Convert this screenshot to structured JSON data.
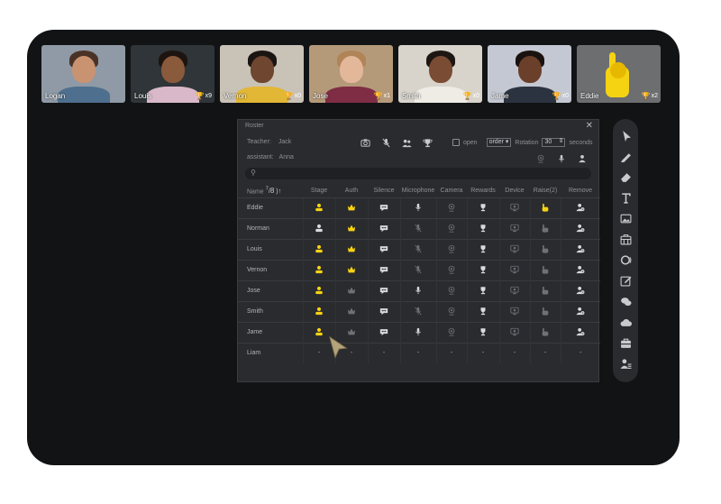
{
  "videos": [
    {
      "name": "Logan",
      "reward": "",
      "bg": "#8f9aa6",
      "skin": "#c99372",
      "hair": "#4a3326",
      "shirt": "#4f6f8e"
    },
    {
      "name": "Louis",
      "reward": "x9",
      "bg": "#2f3538",
      "skin": "#8a5a3c",
      "hair": "#1d1410",
      "shirt": "#d9b8c9"
    },
    {
      "name": "Vernon",
      "reward": "x0",
      "bg": "#c9c2b6",
      "skin": "#6f4630",
      "hair": "#1b1512",
      "shirt": "#e2b735"
    },
    {
      "name": "Jose",
      "reward": "x1",
      "bg": "#b59a7a",
      "skin": "#e3b79a",
      "hair": "#b08456",
      "shirt": "#7e2d45"
    },
    {
      "name": "Smith",
      "reward": "x0",
      "bg": "#d8d4cc",
      "skin": "#7a4c33",
      "hair": "#1e1612",
      "shirt": "#efece6"
    },
    {
      "name": "Jame",
      "reward": "x0",
      "bg": "#c4c8d2",
      "skin": "#6a402b",
      "hair": "#1a120e",
      "shirt": "#2c3340"
    },
    {
      "name": "Eddie",
      "reward": "x2",
      "bg": "#6c6e70",
      "skin": "#f5d312",
      "hair": "#f5d312",
      "shirt": "#f5d312"
    }
  ],
  "roster": {
    "title": "Roster",
    "close": "✕",
    "teacher_label": "Teacher:",
    "teacher_name": "Jack",
    "assistant_label": "assistant:",
    "assistant_name": "Anna",
    "open_label": "open",
    "order_value": "order ▾",
    "rotation_label": "Rotation",
    "rotation_value": "30",
    "seconds_label": "seconds",
    "search_placeholder": "",
    "sort_count": "7",
    "sort_total": "8",
    "columns": [
      "Name",
      "Stage",
      "Auth",
      "Silence",
      "Microphone",
      "Camera",
      "Rewards",
      "Device",
      "Raise(2)",
      "Remove"
    ],
    "rows": [
      {
        "name": "Eddie",
        "stage": "y",
        "auth": "y",
        "silence": "w",
        "mic": "w",
        "camera": "d",
        "rewards": "w",
        "device": "d",
        "raise": "y",
        "remove": "w"
      },
      {
        "name": "Norman",
        "stage": "w",
        "auth": "y",
        "silence": "w",
        "mic": "d",
        "camera": "d",
        "rewards": "w",
        "device": "d",
        "raise": "d",
        "remove": "w"
      },
      {
        "name": "Louis",
        "stage": "y",
        "auth": "y",
        "silence": "w",
        "mic": "d",
        "camera": "d",
        "rewards": "w",
        "device": "d",
        "raise": "d",
        "remove": "w"
      },
      {
        "name": "Vernon",
        "stage": "y",
        "auth": "y",
        "silence": "w",
        "mic": "d",
        "camera": "d",
        "rewards": "w",
        "device": "d",
        "raise": "d",
        "remove": "w"
      },
      {
        "name": "Jose",
        "stage": "y",
        "auth": "d",
        "silence": "w",
        "mic": "w",
        "camera": "d",
        "rewards": "w",
        "device": "d",
        "raise": "d",
        "remove": "w"
      },
      {
        "name": "Smith",
        "stage": "y",
        "auth": "d",
        "silence": "w",
        "mic": "d",
        "camera": "d",
        "rewards": "w",
        "device": "d",
        "raise": "d",
        "remove": "w"
      },
      {
        "name": "Jame",
        "stage": "y",
        "auth": "d",
        "silence": "w",
        "mic": "w",
        "camera": "d",
        "rewards": "w",
        "device": "d",
        "raise": "d",
        "remove": "w"
      },
      {
        "name": "Liam",
        "stage": "-",
        "auth": "-",
        "silence": "-",
        "mic": "-",
        "camera": "-",
        "rewards": "-",
        "device": "-",
        "raise": "-",
        "remove": "-"
      }
    ]
  },
  "toolbar": [
    "select-tool",
    "pen-tool",
    "eraser-tool",
    "text-tool",
    "image-tool",
    "toolbox-tool",
    "laser-tool",
    "edit-tool",
    "chat-tool",
    "cloud-tool",
    "briefcase-tool",
    "roster-tool"
  ],
  "colors": {
    "accent": "#f5d312",
    "panel": "#2a2b2e",
    "background": "#121315"
  }
}
